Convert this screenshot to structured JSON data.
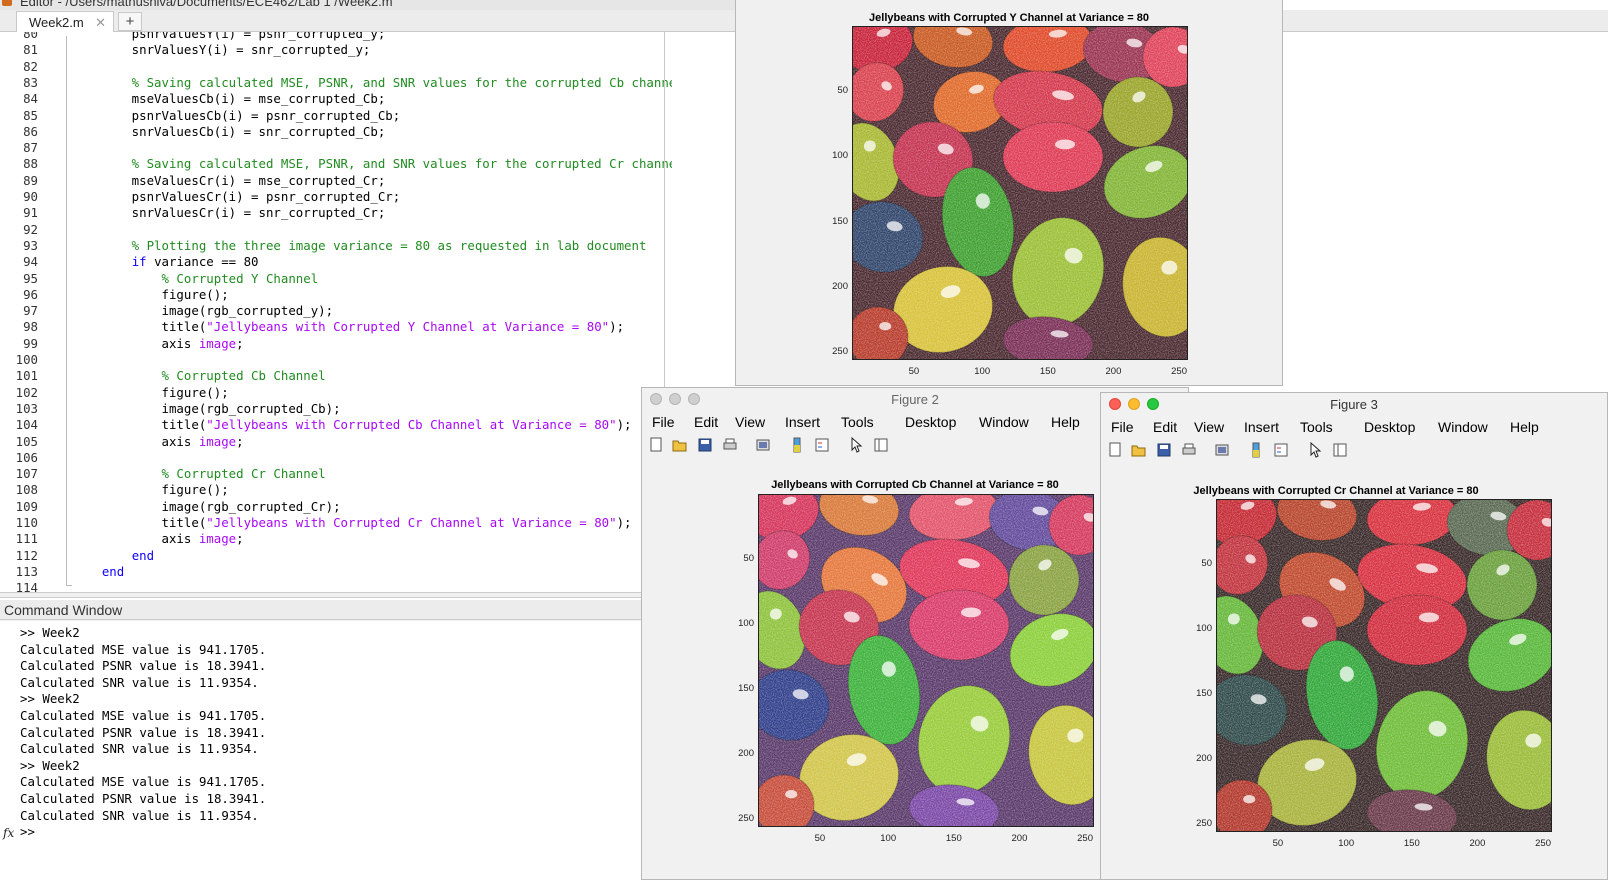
{
  "editor": {
    "title": "Editor - /Users/mathushiva/Documents/ECE462/Lab 1 /Week2.m",
    "tab_label": "Week2.m",
    "tab_close": "✕",
    "tab_add": "+",
    "lines": [
      {
        "n": "80",
        "segs": [
          {
            "t": "        psnrValuesY(i) = psnr_corrupted_y;"
          }
        ]
      },
      {
        "n": "81",
        "segs": [
          {
            "t": "        snrValuesY(i) = snr_corrupted_y;"
          }
        ]
      },
      {
        "n": "82",
        "segs": []
      },
      {
        "n": "83",
        "segs": [
          {
            "t": "        % Saving calculated MSE, PSNR, and SNR values for the corrupted Cb channel",
            "c": "cm"
          }
        ]
      },
      {
        "n": "84",
        "segs": [
          {
            "t": "        mseValuesCb(i) = mse_corrupted_Cb;"
          }
        ]
      },
      {
        "n": "85",
        "segs": [
          {
            "t": "        psnrValuesCb(i) = psnr_corrupted_Cb;"
          }
        ]
      },
      {
        "n": "86",
        "segs": [
          {
            "t": "        snrValuesCb(i) = snr_corrupted_Cb;"
          }
        ]
      },
      {
        "n": "87",
        "segs": []
      },
      {
        "n": "88",
        "segs": [
          {
            "t": "        % Saving calculated MSE, PSNR, and SNR values for the corrupted Cr channel",
            "c": "cm"
          }
        ]
      },
      {
        "n": "89",
        "segs": [
          {
            "t": "        mseValuesCr(i) = mse_corrupted_Cr;"
          }
        ]
      },
      {
        "n": "90",
        "segs": [
          {
            "t": "        psnrValuesCr(i) = psnr_corrupted_Cr;"
          }
        ]
      },
      {
        "n": "91",
        "segs": [
          {
            "t": "        snrValuesCr(i) = snr_corrupted_Cr;"
          }
        ]
      },
      {
        "n": "92",
        "segs": []
      },
      {
        "n": "93",
        "segs": [
          {
            "t": "        % Plotting the three image variance = 80 as requested in lab document",
            "c": "cm"
          }
        ]
      },
      {
        "n": "94",
        "segs": [
          {
            "t": "        "
          },
          {
            "t": "if",
            "c": "kw"
          },
          {
            "t": " variance == 80"
          }
        ]
      },
      {
        "n": "95",
        "segs": [
          {
            "t": "            % Corrupted Y Channel",
            "c": "cm"
          }
        ]
      },
      {
        "n": "96",
        "segs": [
          {
            "t": "            figure();"
          }
        ]
      },
      {
        "n": "97",
        "segs": [
          {
            "t": "            image(rgb_corrupted_y);"
          }
        ]
      },
      {
        "n": "98",
        "segs": [
          {
            "t": "            title("
          },
          {
            "t": "\"Jellybeans with Corrupted Y Channel at Variance = 80\"",
            "c": "st"
          },
          {
            "t": ");"
          }
        ]
      },
      {
        "n": "99",
        "segs": [
          {
            "t": "            axis "
          },
          {
            "t": "image",
            "c": "st"
          },
          {
            "t": ";"
          }
        ]
      },
      {
        "n": "100",
        "segs": []
      },
      {
        "n": "101",
        "segs": [
          {
            "t": "            % Corrupted Cb Channel",
            "c": "cm"
          }
        ]
      },
      {
        "n": "102",
        "segs": [
          {
            "t": "            figure();"
          }
        ]
      },
      {
        "n": "103",
        "segs": [
          {
            "t": "            image(rgb_corrupted_Cb);"
          }
        ]
      },
      {
        "n": "104",
        "segs": [
          {
            "t": "            title("
          },
          {
            "t": "\"Jellybeans with Corrupted Cb Channel at Variance = 80\"",
            "c": "st"
          },
          {
            "t": ");"
          }
        ]
      },
      {
        "n": "105",
        "segs": [
          {
            "t": "            axis "
          },
          {
            "t": "image",
            "c": "st"
          },
          {
            "t": ";"
          }
        ]
      },
      {
        "n": "106",
        "segs": []
      },
      {
        "n": "107",
        "segs": [
          {
            "t": "            % Corrupted Cr Channel",
            "c": "cm"
          }
        ]
      },
      {
        "n": "108",
        "segs": [
          {
            "t": "            figure();"
          }
        ]
      },
      {
        "n": "109",
        "segs": [
          {
            "t": "            image(rgb_corrupted_Cr);"
          }
        ]
      },
      {
        "n": "110",
        "segs": [
          {
            "t": "            title("
          },
          {
            "t": "\"Jellybeans with Corrupted Cr Channel at Variance = 80\"",
            "c": "st"
          },
          {
            "t": ");"
          }
        ]
      },
      {
        "n": "111",
        "segs": [
          {
            "t": "            axis "
          },
          {
            "t": "image",
            "c": "st"
          },
          {
            "t": ";"
          }
        ]
      },
      {
        "n": "112",
        "segs": [
          {
            "t": "        "
          },
          {
            "t": "end",
            "c": "kw"
          }
        ]
      },
      {
        "n": "113",
        "segs": [
          {
            "t": "    "
          },
          {
            "t": "end",
            "c": "kw"
          }
        ]
      },
      {
        "n": "114",
        "segs": []
      }
    ]
  },
  "command_window": {
    "title": "Command Window",
    "lines": [
      ">> Week2",
      "Calculated MSE value is 941.1705.",
      "Calculated PSNR value is 18.3941.",
      "Calculated SNR value is 11.9354.",
      ">> Week2",
      "Calculated MSE value is 941.1705.",
      "Calculated PSNR value is 18.3941.",
      "Calculated SNR value is 11.9354.",
      ">> Week2",
      "Calculated MSE value is 941.1705.",
      "Calculated PSNR value is 18.3941.",
      "Calculated SNR value is 11.9354."
    ],
    "fx_label": "fx",
    "prompt": ">>"
  },
  "figures": {
    "fig1": {
      "plot_title": "Jellybeans with Corrupted Y Channel at Variance = 80",
      "y_ticks": [
        "50",
        "100",
        "150",
        "200",
        "250"
      ],
      "x_ticks": [
        "50",
        "100",
        "150",
        "200",
        "250"
      ],
      "beans": [
        [
          "#c8233a",
          -10,
          -10,
          70,
          55,
          -15
        ],
        [
          "#c95a22",
          60,
          -15,
          80,
          55,
          10
        ],
        [
          "#e04a2a",
          150,
          -10,
          90,
          55,
          -5
        ],
        [
          "#9a3452",
          230,
          -5,
          80,
          60,
          10
        ],
        [
          "#e0435a",
          290,
          0,
          60,
          60,
          20
        ],
        [
          "#d9424e",
          -5,
          35,
          55,
          60,
          30
        ],
        [
          "#e06a2a",
          80,
          45,
          75,
          60,
          -15
        ],
        [
          "#d4394c",
          140,
          45,
          110,
          65,
          10
        ],
        [
          "#9aa52a",
          250,
          50,
          70,
          70,
          -30
        ],
        [
          "#a9b832",
          -15,
          95,
          60,
          80,
          -20
        ],
        [
          "#c43350",
          40,
          95,
          80,
          75,
          15
        ],
        [
          "#df3b55",
          150,
          95,
          100,
          70,
          0
        ],
        [
          "#82b536",
          250,
          120,
          90,
          70,
          -20
        ],
        [
          "#30456b",
          -10,
          175,
          80,
          70,
          10
        ],
        [
          "#3fa030",
          90,
          140,
          70,
          110,
          -10
        ],
        [
          "#9bbf35",
          160,
          190,
          90,
          110,
          15
        ],
        [
          "#c9b430",
          270,
          210,
          80,
          100,
          -10
        ],
        [
          "#d8c23a",
          40,
          240,
          100,
          85,
          -15
        ],
        [
          "#b83c2c",
          -5,
          280,
          60,
          60,
          0
        ],
        [
          "#7a2f56",
          150,
          290,
          90,
          50,
          5
        ]
      ]
    },
    "fig2": {
      "window_title": "Figure 2",
      "menu": [
        "File",
        "Edit",
        "View",
        "Insert",
        "Tools",
        "Desktop",
        "Window",
        "Help"
      ],
      "plot_title": "Jellybeans with Corrupted Cb Channel at Variance = 80",
      "y_ticks": [
        "50",
        "100",
        "150",
        "200",
        "250"
      ],
      "x_ticks": [
        "50",
        "100",
        "150",
        "200",
        "250"
      ],
      "beans": [
        [
          "#d6355c",
          -10,
          -10,
          70,
          55,
          -15
        ],
        [
          "#d97a3a",
          60,
          -15,
          80,
          55,
          10
        ],
        [
          "#e3546a",
          150,
          -10,
          90,
          55,
          -5
        ],
        [
          "#624b9c",
          230,
          -5,
          80,
          60,
          10
        ],
        [
          "#d53a5e",
          290,
          0,
          60,
          60,
          20
        ],
        [
          "#cf3c6a",
          -5,
          35,
          55,
          60,
          30
        ],
        [
          "#e6783c",
          60,
          55,
          90,
          70,
          30
        ],
        [
          "#e0375a",
          140,
          45,
          110,
          65,
          10
        ],
        [
          "#8aa242",
          250,
          50,
          70,
          70,
          -30
        ],
        [
          "#8ec23c",
          -15,
          95,
          60,
          80,
          -20
        ],
        [
          "#c6354f",
          40,
          95,
          80,
          75,
          15
        ],
        [
          "#d93b6a",
          150,
          95,
          100,
          70,
          0
        ],
        [
          "#8ccf3a",
          250,
          120,
          90,
          70,
          -20
        ],
        [
          "#2f3f8a",
          -10,
          175,
          80,
          70,
          10
        ],
        [
          "#3cb23a",
          90,
          140,
          70,
          110,
          -10
        ],
        [
          "#98cc3a",
          160,
          190,
          90,
          110,
          15
        ],
        [
          "#c7c63f",
          270,
          210,
          80,
          100,
          -10
        ],
        [
          "#d1c54a",
          40,
          240,
          100,
          85,
          -15
        ],
        [
          "#c74d3a",
          -5,
          280,
          60,
          60,
          0
        ],
        [
          "#7a48a6",
          150,
          290,
          90,
          50,
          5
        ]
      ]
    },
    "fig3": {
      "window_title": "Figure 3",
      "menu": [
        "File",
        "Edit",
        "View",
        "Insert",
        "Tools",
        "Desktop",
        "Window",
        "Help"
      ],
      "plot_title": "Jellybeans with Corrupted Cr Channel at Variance = 80",
      "y_ticks": [
        "50",
        "100",
        "150",
        "200",
        "250"
      ],
      "x_ticks": [
        "50",
        "100",
        "150",
        "200",
        "250"
      ],
      "beans": [
        [
          "#c52a34",
          -10,
          -10,
          70,
          55,
          -15
        ],
        [
          "#b7452c",
          60,
          -15,
          80,
          55,
          10
        ],
        [
          "#d8323e",
          150,
          -10,
          90,
          55,
          -5
        ],
        [
          "#5a6a52",
          230,
          -5,
          80,
          60,
          10
        ],
        [
          "#c62e3c",
          290,
          0,
          60,
          60,
          20
        ],
        [
          "#c2343e",
          -5,
          35,
          55,
          60,
          30
        ],
        [
          "#c04a2e",
          60,
          55,
          90,
          70,
          30
        ],
        [
          "#d83040",
          140,
          45,
          110,
          65,
          10
        ],
        [
          "#6aa03c",
          250,
          50,
          70,
          70,
          -30
        ],
        [
          "#66b83a",
          -15,
          95,
          60,
          80,
          -20
        ],
        [
          "#b8303e",
          40,
          95,
          80,
          75,
          15
        ],
        [
          "#d12d3e",
          150,
          95,
          100,
          70,
          0
        ],
        [
          "#58b83a",
          250,
          120,
          90,
          70,
          -20
        ],
        [
          "#2f4a4a",
          -10,
          175,
          80,
          70,
          10
        ],
        [
          "#31a83a",
          90,
          140,
          70,
          110,
          -10
        ],
        [
          "#6fbd38",
          160,
          190,
          90,
          110,
          15
        ],
        [
          "#9abc38",
          270,
          210,
          80,
          100,
          -10
        ],
        [
          "#a8b33c",
          40,
          240,
          100,
          85,
          -15
        ],
        [
          "#b2382c",
          -5,
          280,
          60,
          60,
          0
        ],
        [
          "#6a3a4a",
          150,
          290,
          90,
          50,
          5
        ]
      ]
    }
  }
}
